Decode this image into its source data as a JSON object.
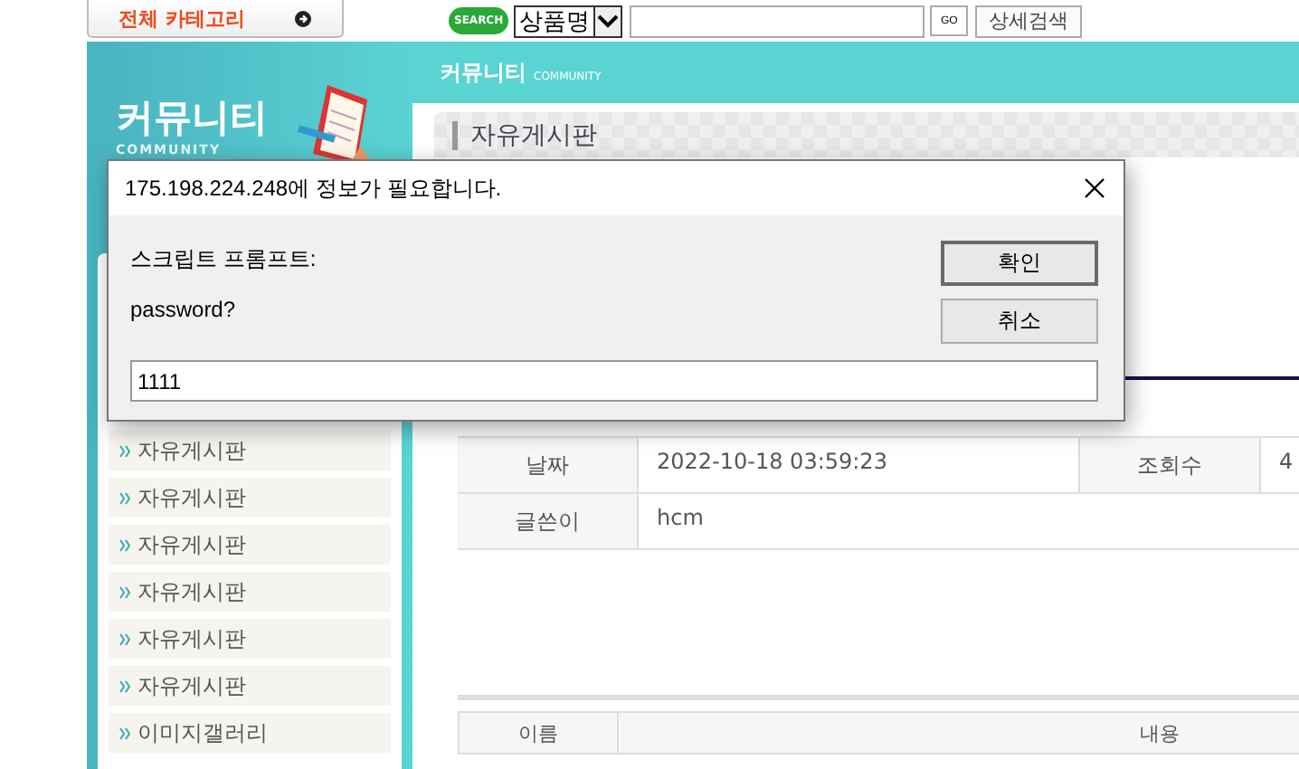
{
  "top_bar": {
    "category_button": "전체 카테고리",
    "search_logo": "SEARCH",
    "search_select": "상품명",
    "go_button": "GO",
    "detail_search_button": "상세검색"
  },
  "header": {
    "title": "커뮤니티",
    "subtitle": "COMMUNITY"
  },
  "sidebar": {
    "title": "커뮤니티",
    "subtitle": "COMMUNITY",
    "items": [
      {
        "label": "자유게시판"
      },
      {
        "label": "자유게시판"
      },
      {
        "label": "자유게시판"
      },
      {
        "label": "자유게시판"
      },
      {
        "label": "자유게시판"
      },
      {
        "label": "자유게시판"
      },
      {
        "label": "이미지갤러리"
      }
    ]
  },
  "board": {
    "title": "자유게시판",
    "rows": [
      {
        "cells": [
          {
            "kind": "label",
            "text": "날짜"
          },
          {
            "kind": "value",
            "text": "2022-10-18 03:59:23"
          },
          {
            "kind": "label",
            "text": "조회수"
          },
          {
            "kind": "value",
            "text": "4"
          }
        ]
      },
      {
        "cells": [
          {
            "kind": "label",
            "text": "글쓴이"
          },
          {
            "kind": "wide",
            "text": "hcm"
          }
        ]
      }
    ]
  },
  "comments": {
    "columns": [
      "이름",
      "내용"
    ]
  },
  "dialog": {
    "title": "175.198.224.248에 정보가 필요합니다.",
    "prompt_label": "스크립트 프롬프트:",
    "message": "password?",
    "input": {
      "value": "1111"
    },
    "buttons": [
      {
        "label": "확인",
        "default": true
      },
      {
        "label": "취소",
        "default": false
      }
    ]
  }
}
